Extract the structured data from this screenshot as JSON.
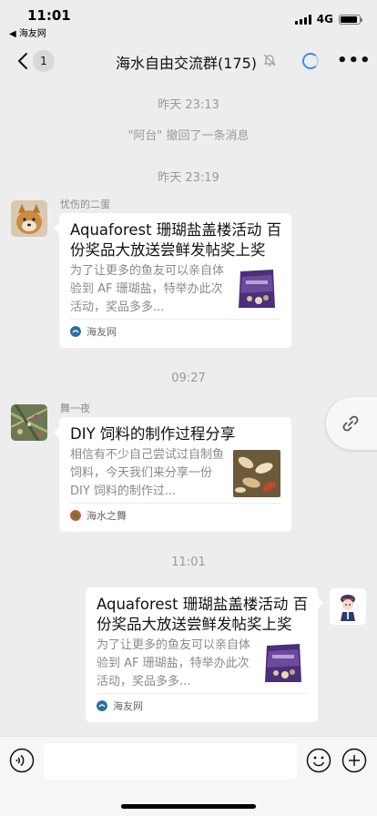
{
  "status_bar": {
    "time": "11:01",
    "back_to_app": "◀ 海友网",
    "network": "4G",
    "battery_level": 0.9
  },
  "nav": {
    "unread_count": "1",
    "title": "海水自由交流群(175)"
  },
  "chat": {
    "messages": [
      {
        "type": "timestamp",
        "text": "昨天 23:13"
      },
      {
        "type": "system",
        "text": "\"阿台\" 撤回了一条消息"
      },
      {
        "type": "timestamp",
        "text": "昨天 23:19"
      },
      {
        "type": "link_card",
        "sender": "忧伤的二蛋",
        "title": "Aquaforest 珊瑚盐盖楼活动 百份奖品大放送尝鲜发帖奖上奖",
        "desc": "为了让更多的鱼友可以亲自体验到 AF 珊瑚盐，特举办此次活动，奖品多多...",
        "source": "海友网"
      },
      {
        "type": "timestamp",
        "text": "09:27"
      },
      {
        "type": "link_card",
        "sender": "舞一夜",
        "title": "DIY 饲料的制作过程分享",
        "desc": "相信有不少自己尝试过自制鱼饲料，今天我们来分享一份 DIY 饲料的制作过...",
        "source": "海水之舞"
      },
      {
        "type": "timestamp",
        "text": "11:01"
      },
      {
        "type": "link_card_self",
        "title": "Aquaforest 珊瑚盐盖楼活动 百份奖品大放送尝鲜发帖奖上奖",
        "desc": "为了让更多的鱼友可以亲自体验到 AF 珊瑚盐，特举办此次活动，奖品多多...",
        "source": "海友网"
      }
    ]
  },
  "input_bar": {
    "voice_icon": "voice-icon",
    "emoji_icon": "emoji-icon",
    "plus_icon": "plus-icon"
  },
  "colors": {
    "background": "#ededed",
    "card": "#ffffff",
    "muted_text": "#9a9a9a",
    "accent_loading": "#3b8ee8"
  }
}
